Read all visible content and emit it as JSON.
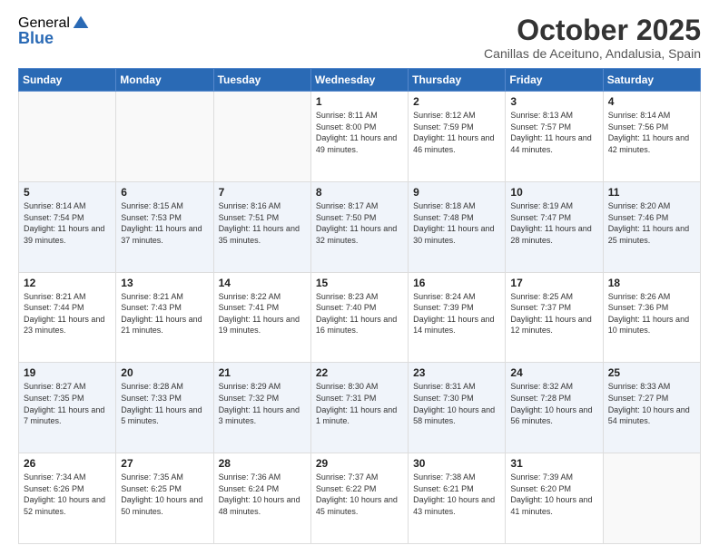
{
  "logo": {
    "general": "General",
    "blue": "Blue"
  },
  "header": {
    "month": "October 2025",
    "location": "Canillas de Aceituno, Andalusia, Spain"
  },
  "weekdays": [
    "Sunday",
    "Monday",
    "Tuesday",
    "Wednesday",
    "Thursday",
    "Friday",
    "Saturday"
  ],
  "weeks": [
    [
      {
        "day": "",
        "info": ""
      },
      {
        "day": "",
        "info": ""
      },
      {
        "day": "",
        "info": ""
      },
      {
        "day": "1",
        "info": "Sunrise: 8:11 AM\nSunset: 8:00 PM\nDaylight: 11 hours and 49 minutes."
      },
      {
        "day": "2",
        "info": "Sunrise: 8:12 AM\nSunset: 7:59 PM\nDaylight: 11 hours and 46 minutes."
      },
      {
        "day": "3",
        "info": "Sunrise: 8:13 AM\nSunset: 7:57 PM\nDaylight: 11 hours and 44 minutes."
      },
      {
        "day": "4",
        "info": "Sunrise: 8:14 AM\nSunset: 7:56 PM\nDaylight: 11 hours and 42 minutes."
      }
    ],
    [
      {
        "day": "5",
        "info": "Sunrise: 8:14 AM\nSunset: 7:54 PM\nDaylight: 11 hours and 39 minutes."
      },
      {
        "day": "6",
        "info": "Sunrise: 8:15 AM\nSunset: 7:53 PM\nDaylight: 11 hours and 37 minutes."
      },
      {
        "day": "7",
        "info": "Sunrise: 8:16 AM\nSunset: 7:51 PM\nDaylight: 11 hours and 35 minutes."
      },
      {
        "day": "8",
        "info": "Sunrise: 8:17 AM\nSunset: 7:50 PM\nDaylight: 11 hours and 32 minutes."
      },
      {
        "day": "9",
        "info": "Sunrise: 8:18 AM\nSunset: 7:48 PM\nDaylight: 11 hours and 30 minutes."
      },
      {
        "day": "10",
        "info": "Sunrise: 8:19 AM\nSunset: 7:47 PM\nDaylight: 11 hours and 28 minutes."
      },
      {
        "day": "11",
        "info": "Sunrise: 8:20 AM\nSunset: 7:46 PM\nDaylight: 11 hours and 25 minutes."
      }
    ],
    [
      {
        "day": "12",
        "info": "Sunrise: 8:21 AM\nSunset: 7:44 PM\nDaylight: 11 hours and 23 minutes."
      },
      {
        "day": "13",
        "info": "Sunrise: 8:21 AM\nSunset: 7:43 PM\nDaylight: 11 hours and 21 minutes."
      },
      {
        "day": "14",
        "info": "Sunrise: 8:22 AM\nSunset: 7:41 PM\nDaylight: 11 hours and 19 minutes."
      },
      {
        "day": "15",
        "info": "Sunrise: 8:23 AM\nSunset: 7:40 PM\nDaylight: 11 hours and 16 minutes."
      },
      {
        "day": "16",
        "info": "Sunrise: 8:24 AM\nSunset: 7:39 PM\nDaylight: 11 hours and 14 minutes."
      },
      {
        "day": "17",
        "info": "Sunrise: 8:25 AM\nSunset: 7:37 PM\nDaylight: 11 hours and 12 minutes."
      },
      {
        "day": "18",
        "info": "Sunrise: 8:26 AM\nSunset: 7:36 PM\nDaylight: 11 hours and 10 minutes."
      }
    ],
    [
      {
        "day": "19",
        "info": "Sunrise: 8:27 AM\nSunset: 7:35 PM\nDaylight: 11 hours and 7 minutes."
      },
      {
        "day": "20",
        "info": "Sunrise: 8:28 AM\nSunset: 7:33 PM\nDaylight: 11 hours and 5 minutes."
      },
      {
        "day": "21",
        "info": "Sunrise: 8:29 AM\nSunset: 7:32 PM\nDaylight: 11 hours and 3 minutes."
      },
      {
        "day": "22",
        "info": "Sunrise: 8:30 AM\nSunset: 7:31 PM\nDaylight: 11 hours and 1 minute."
      },
      {
        "day": "23",
        "info": "Sunrise: 8:31 AM\nSunset: 7:30 PM\nDaylight: 10 hours and 58 minutes."
      },
      {
        "day": "24",
        "info": "Sunrise: 8:32 AM\nSunset: 7:28 PM\nDaylight: 10 hours and 56 minutes."
      },
      {
        "day": "25",
        "info": "Sunrise: 8:33 AM\nSunset: 7:27 PM\nDaylight: 10 hours and 54 minutes."
      }
    ],
    [
      {
        "day": "26",
        "info": "Sunrise: 7:34 AM\nSunset: 6:26 PM\nDaylight: 10 hours and 52 minutes."
      },
      {
        "day": "27",
        "info": "Sunrise: 7:35 AM\nSunset: 6:25 PM\nDaylight: 10 hours and 50 minutes."
      },
      {
        "day": "28",
        "info": "Sunrise: 7:36 AM\nSunset: 6:24 PM\nDaylight: 10 hours and 48 minutes."
      },
      {
        "day": "29",
        "info": "Sunrise: 7:37 AM\nSunset: 6:22 PM\nDaylight: 10 hours and 45 minutes."
      },
      {
        "day": "30",
        "info": "Sunrise: 7:38 AM\nSunset: 6:21 PM\nDaylight: 10 hours and 43 minutes."
      },
      {
        "day": "31",
        "info": "Sunrise: 7:39 AM\nSunset: 6:20 PM\nDaylight: 10 hours and 41 minutes."
      },
      {
        "day": "",
        "info": ""
      }
    ]
  ]
}
